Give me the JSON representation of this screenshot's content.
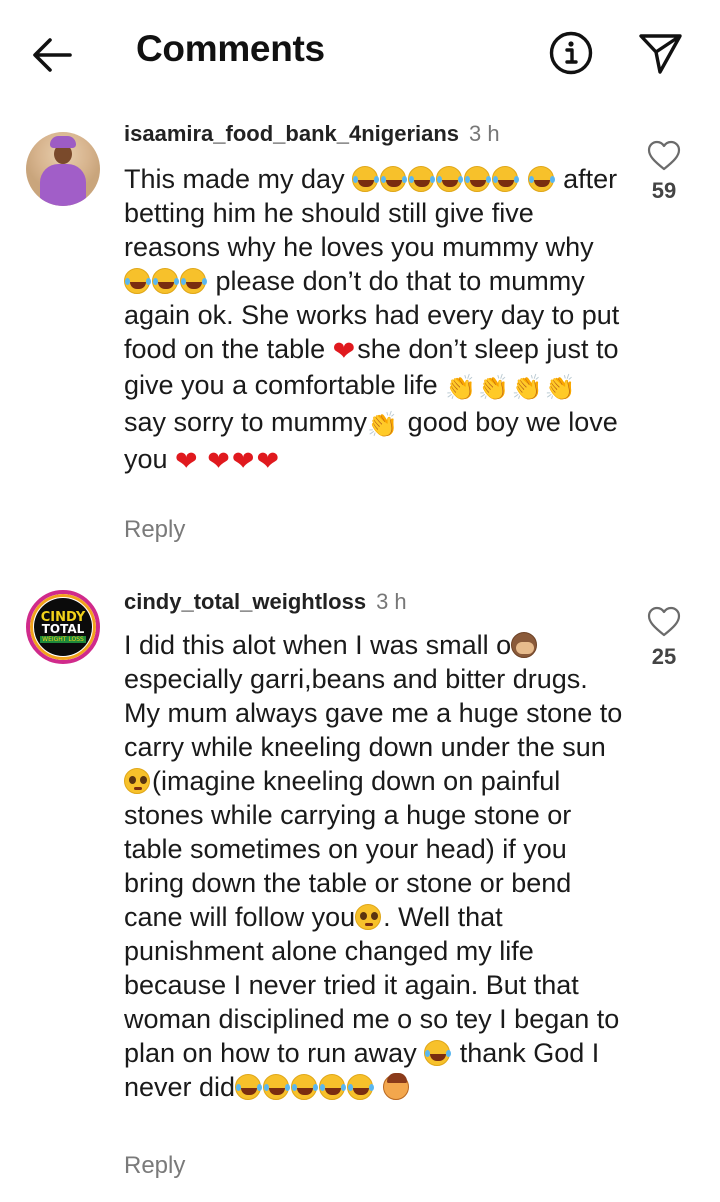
{
  "header": {
    "title": "Comments",
    "back_icon": "arrow-left-icon",
    "info_icon": "info-icon",
    "share_icon": "paper-plane-icon"
  },
  "comments": [
    {
      "username": "isaamira_food_bank_4nigerians",
      "time": "3 h",
      "likes": "59",
      "reply_label": "Reply",
      "text_parts": [
        "This made my day ",
        " after betting him he should still give five reasons why he loves you mummy why ",
        " please don’t do that to mummy again ok. She works had every day to put food on the table ",
        "she don’t sleep just to give you a comfortable life ",
        " say sorry to mummy",
        " good boy we love you "
      ]
    },
    {
      "username": "cindy_total_weightloss",
      "time": "3 h",
      "likes": "25",
      "reply_label": "Reply",
      "avatar_logo": [
        "CINDY",
        "TOTAL",
        "WEIGHT LOSS"
      ],
      "text_parts": [
        "I did this alot when I was small o",
        " especially garri,beans and bitter drugs. My mum always gave me a huge stone to carry while kneeling down  under the sun",
        "(imagine kneeling down on painful stones while carrying a huge stone or table sometimes on your head) if you bring down the table or stone or bend cane will follow you",
        ". Well  that punishment alone changed my life because I never tried it again. But that woman disciplined me o so tey I began to plan on how to run away ",
        " thank God I never did"
      ]
    }
  ],
  "colors": {
    "text": "#1a1a1a",
    "muted": "#777777",
    "heart_emoji": "#e0191e"
  }
}
